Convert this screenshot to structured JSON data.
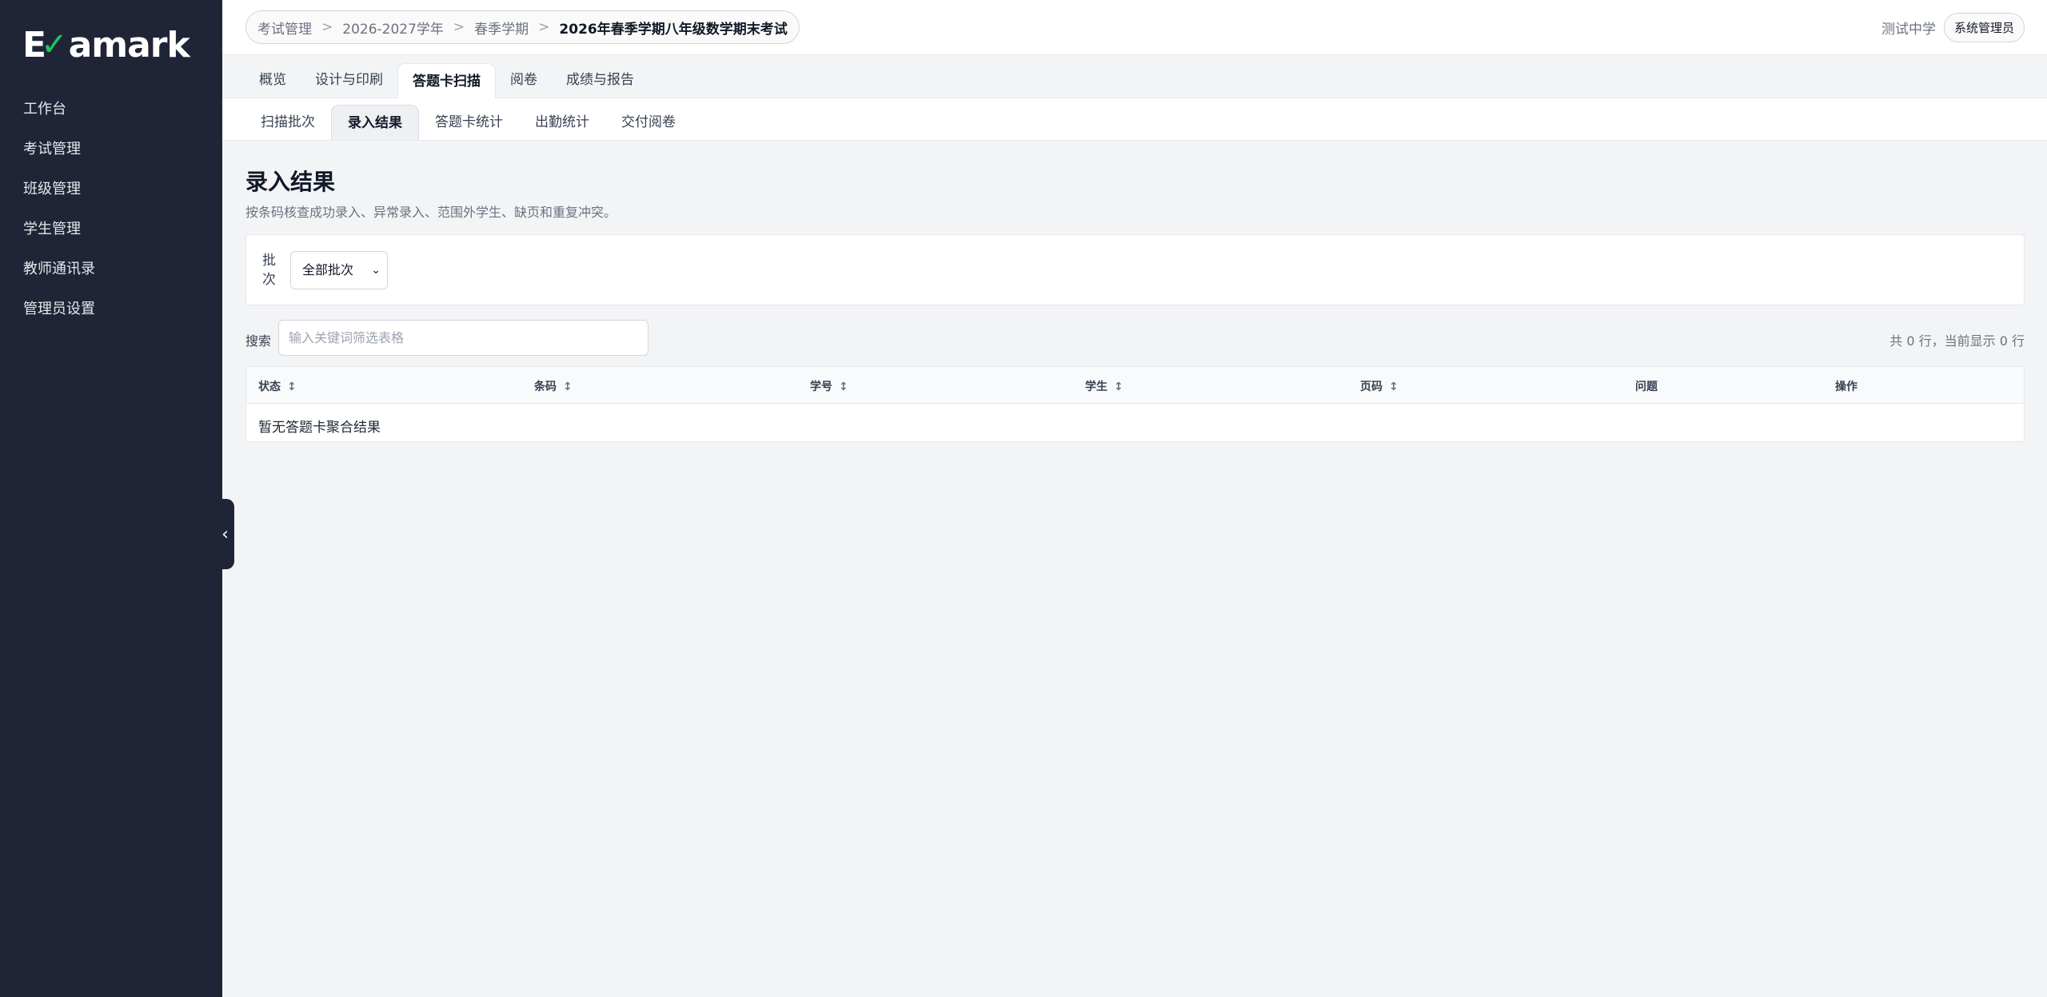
{
  "app": {
    "logo_text": "Examark"
  },
  "sidebar": {
    "items": [
      {
        "label": "工作台"
      },
      {
        "label": "考试管理"
      },
      {
        "label": "班级管理"
      },
      {
        "label": "学生管理"
      },
      {
        "label": "教师通讯录"
      },
      {
        "label": "管理员设置"
      }
    ],
    "collapse_icon": "chevron-left-icon"
  },
  "header": {
    "breadcrumb": [
      "考试管理",
      "2026-2027学年",
      "春季学期",
      "2026年春季学期八年级数学期末考试"
    ],
    "separator": ">",
    "school": "测试中学",
    "role": "系统管理员"
  },
  "main_tabs": [
    {
      "label": "概览"
    },
    {
      "label": "设计与印刷"
    },
    {
      "label": "答题卡扫描",
      "active": true
    },
    {
      "label": "阅卷"
    },
    {
      "label": "成绩与报告"
    }
  ],
  "sub_tabs": [
    {
      "label": "扫描批次"
    },
    {
      "label": "录入结果",
      "active": true
    },
    {
      "label": "答题卡统计"
    },
    {
      "label": "出勤统计"
    },
    {
      "label": "交付阅卷"
    }
  ],
  "page": {
    "title": "录入结果",
    "description": "按条码核查成功录入、异常录入、范围外学生、缺页和重复冲突。"
  },
  "filter": {
    "batch_label": "批次",
    "batch_value": "全部批次"
  },
  "search": {
    "label": "搜索",
    "placeholder": "输入关键词筛选表格",
    "row_count": "共 0 行，当前显示 0 行"
  },
  "table": {
    "columns": [
      "状态",
      "条码",
      "学号",
      "学生",
      "页码",
      "问题",
      "操作"
    ],
    "sortable": [
      true,
      true,
      true,
      true,
      true,
      false,
      false
    ],
    "empty_text": "暂无答题卡聚合结果"
  },
  "colors": {
    "sidebar_bg": "#1f2537",
    "logo_check": "#22c55e",
    "page_bg": "#f3f4f6"
  }
}
